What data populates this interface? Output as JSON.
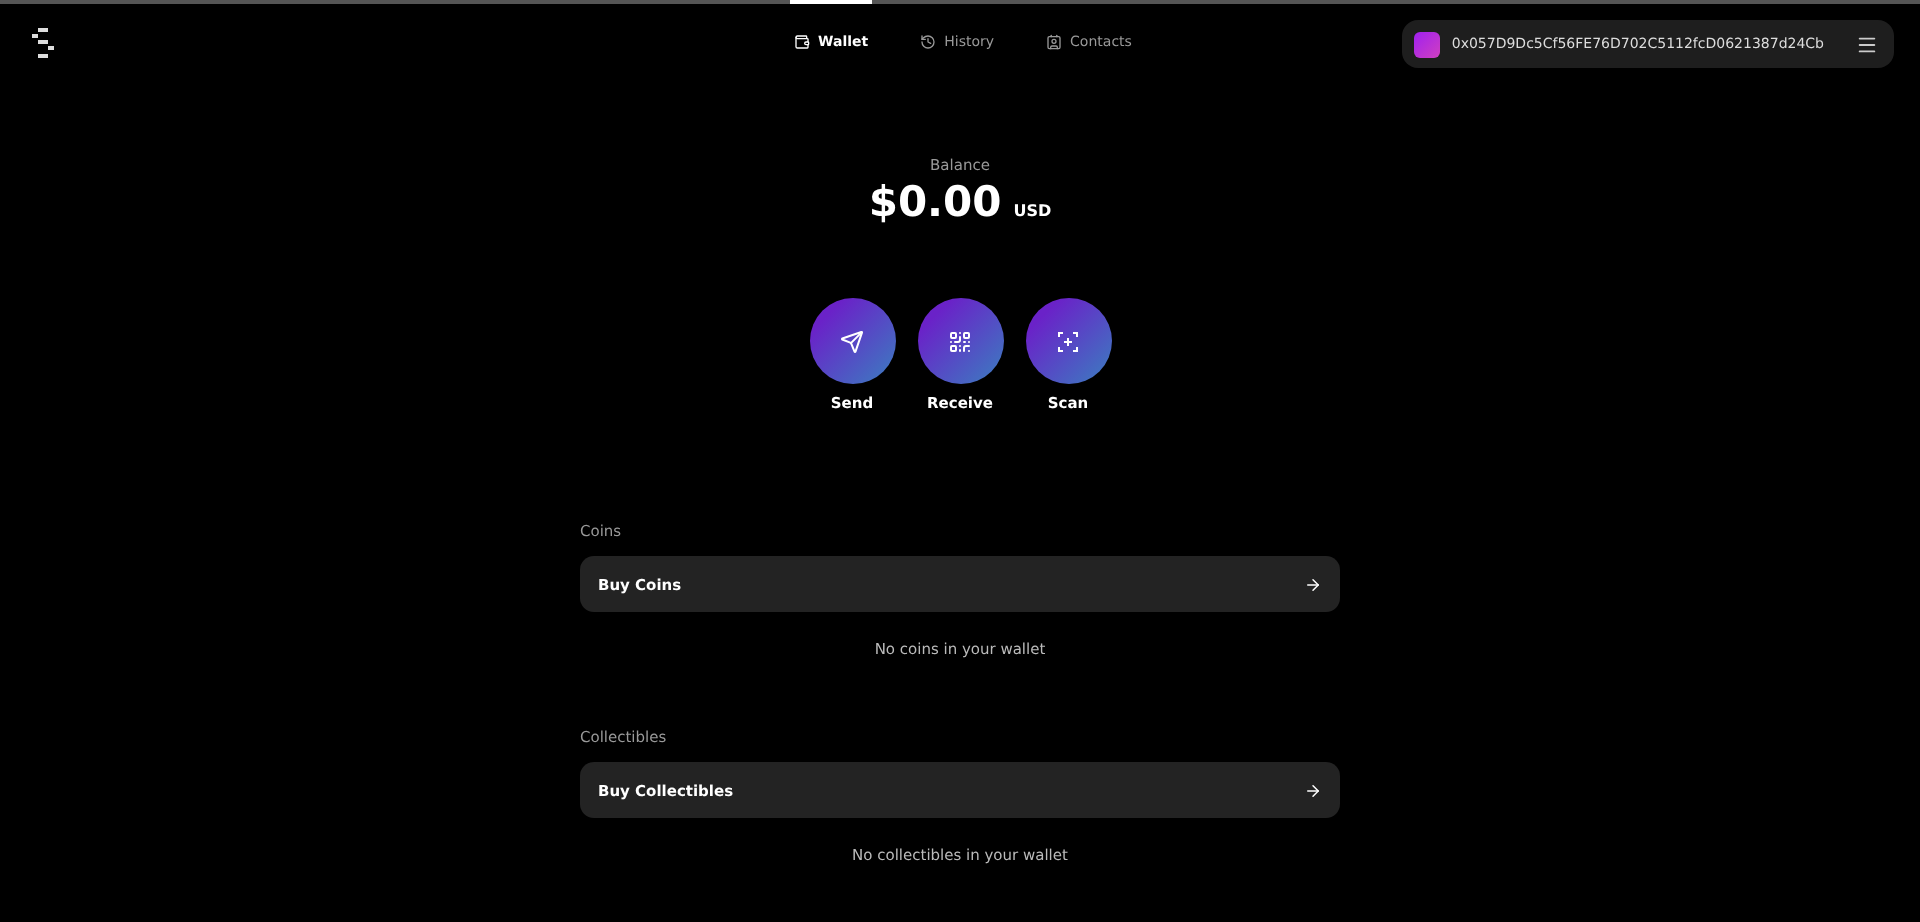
{
  "nav": {
    "tabs": [
      {
        "label": "Wallet",
        "selected": true
      },
      {
        "label": "History",
        "selected": false
      },
      {
        "label": "Contacts",
        "selected": false
      }
    ]
  },
  "account": {
    "address": "0x057D9Dc5Cf56FE76D702C5112fcD0621387d24Cb"
  },
  "balance": {
    "label": "Balance",
    "amount": "$0.00",
    "currency": "USD"
  },
  "actions": [
    {
      "label": "Send"
    },
    {
      "label": "Receive"
    },
    {
      "label": "Scan"
    }
  ],
  "sections": [
    {
      "title": "Coins",
      "button": "Buy Coins",
      "empty": "No coins in your wallet"
    },
    {
      "title": "Collectibles",
      "button": "Buy Collectibles",
      "empty": "No collectibles in your wallet"
    }
  ]
}
